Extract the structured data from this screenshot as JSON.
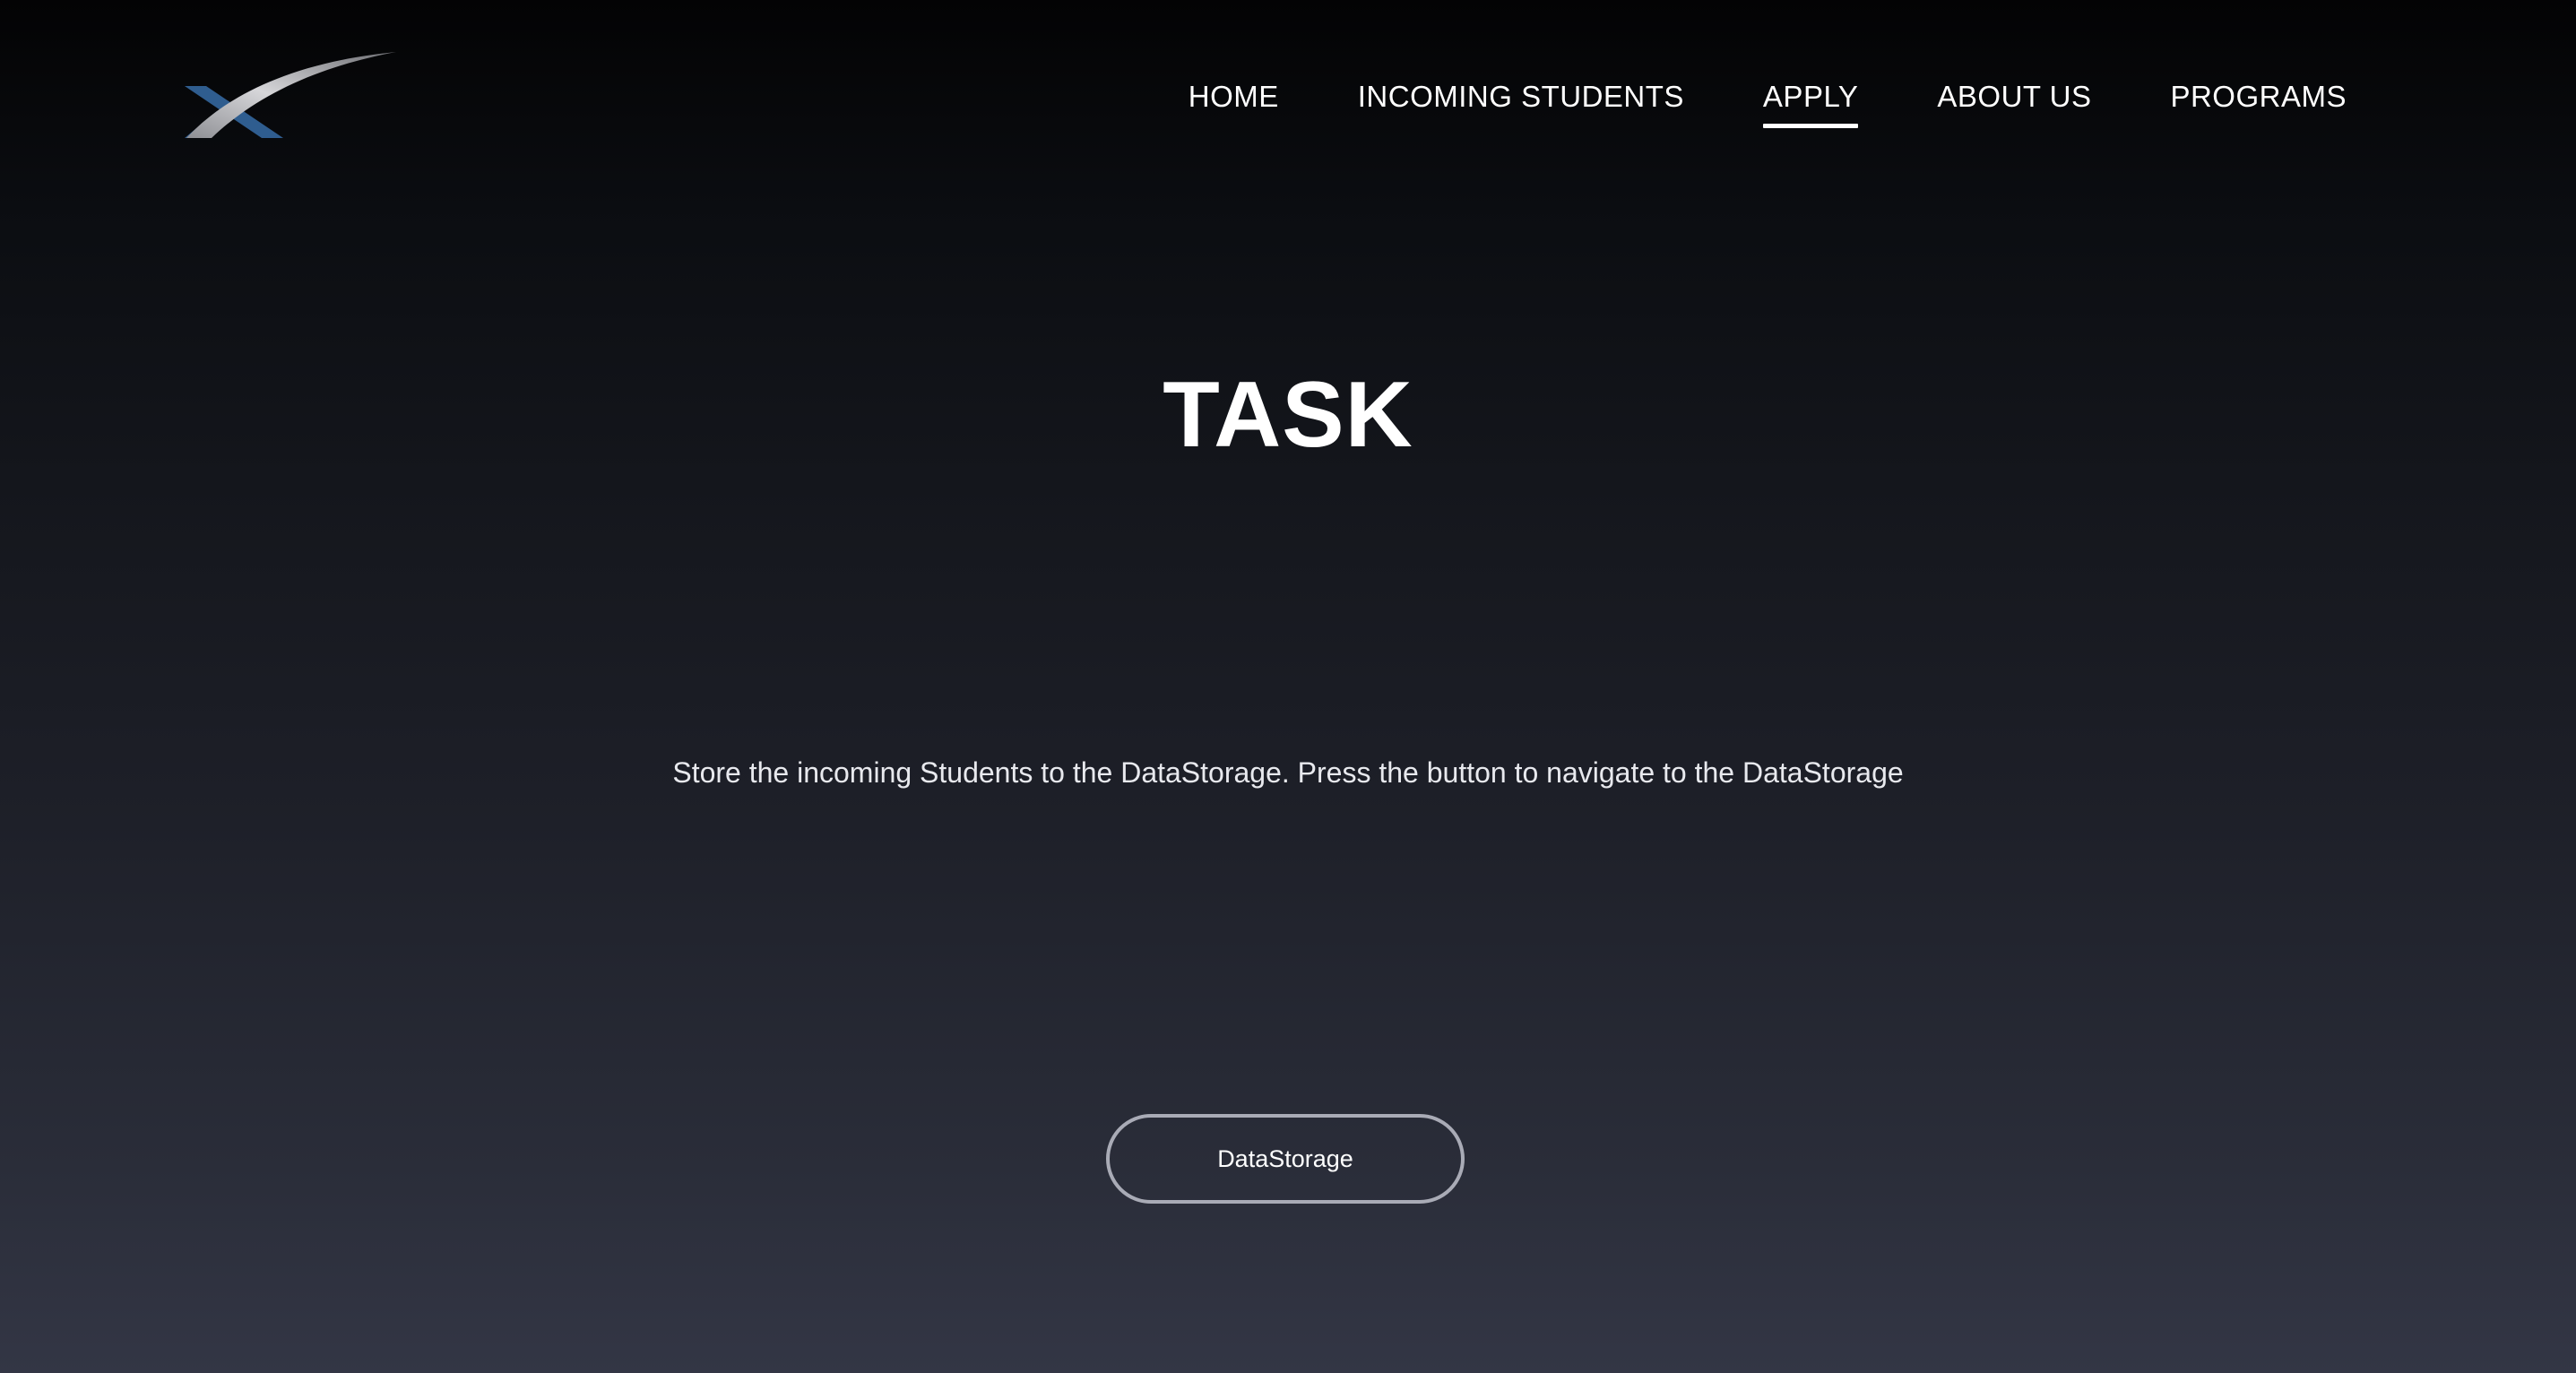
{
  "brand": {
    "logo_icon": "swoosh-x-logo",
    "colors": {
      "logo_blue": "#2f5d8f",
      "logo_silver": "#c9c9cc"
    }
  },
  "nav": {
    "items": [
      {
        "label": "HOME",
        "active": false
      },
      {
        "label": "INCOMING STUDENTS",
        "active": false
      },
      {
        "label": "APPLY",
        "active": true
      },
      {
        "label": "ABOUT US",
        "active": false
      },
      {
        "label": "PROGRAMS",
        "active": false
      }
    ]
  },
  "main": {
    "title": "TASK",
    "description": "Store the incoming Students to the DataStorage. Press the button to navigate to the DataStorage",
    "button_label": "DataStorage"
  },
  "colors": {
    "background_top": "#030304",
    "background_bottom": "#333645",
    "text": "#ffffff",
    "button_border": "#a9abb6"
  }
}
